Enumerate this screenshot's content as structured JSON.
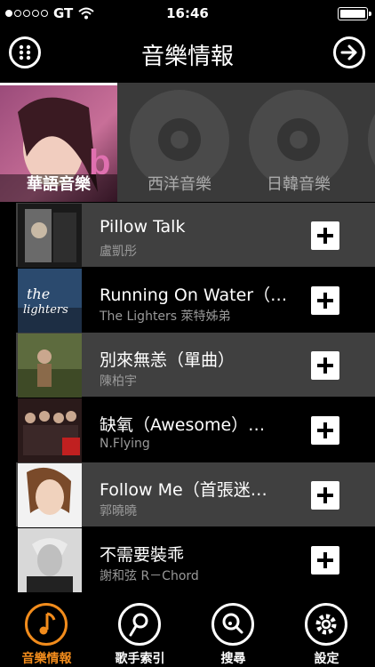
{
  "status": {
    "carrier": "GT",
    "time": "16:46"
  },
  "nav": {
    "title": "音樂情報"
  },
  "categories": [
    {
      "label": "華語音樂",
      "active": true
    },
    {
      "label": "西洋音樂",
      "active": false
    },
    {
      "label": "日韓音樂",
      "active": false
    }
  ],
  "songs": [
    {
      "title": "Pillow Talk",
      "artist": "盧凱彤"
    },
    {
      "title": "Running On Water（…",
      "artist": "The Lighters 萊特姊弟"
    },
    {
      "title": "別來無恙（單曲）",
      "artist": "陳柏宇"
    },
    {
      "title": "缺氧（Awesome）…",
      "artist": "N.Flying"
    },
    {
      "title": "Follow Me（首張迷…",
      "artist": "郭曉曉"
    },
    {
      "title": "不需要裝乖",
      "artist": "謝和弦 R－Chord"
    }
  ],
  "tabs": [
    {
      "label": "音樂情報",
      "icon": "music-note-icon",
      "active": true
    },
    {
      "label": "歌手索引",
      "icon": "singer-index-icon",
      "active": false
    },
    {
      "label": "搜尋",
      "icon": "search-music-icon",
      "active": false
    },
    {
      "label": "設定",
      "icon": "gear-icon",
      "active": false
    }
  ],
  "colors": {
    "accent": "#f28c1c",
    "row_alt": "#404040"
  }
}
